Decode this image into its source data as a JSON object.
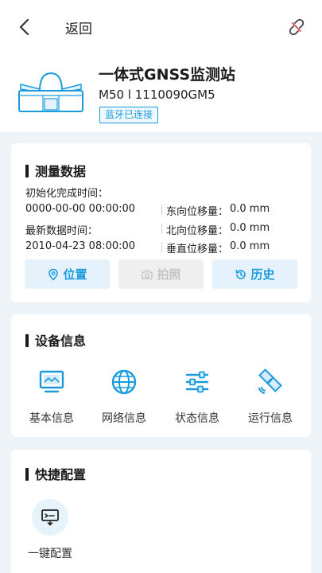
{
  "header": {
    "back_label": "返回"
  },
  "device": {
    "name": "一体式GNSS监测站",
    "model": "M50 l 1110090GM5",
    "bluetooth_status": "蓝牙已连接"
  },
  "measurement": {
    "title": "测量数据",
    "init_label": "初始化完成时间：",
    "init_time": "0000-00-00 00:00:00",
    "latest_label": "最新数据时间：",
    "latest_time": "2010-04-23 08:00:00",
    "east_label": "东向位移量：",
    "east_value": "0.0 mm",
    "north_label": "北向位移量：",
    "north_value": "0.0 mm",
    "vertical_label": "垂直位移量：",
    "vertical_value": "0.0 mm",
    "buttons": {
      "location": "位置",
      "photo": "拍照",
      "history": "历史"
    }
  },
  "device_info": {
    "title": "设备信息",
    "items": [
      {
        "label": "基本信息",
        "icon": "monitor-icon"
      },
      {
        "label": "网络信息",
        "icon": "globe-icon"
      },
      {
        "label": "状态信息",
        "icon": "sliders-icon"
      },
      {
        "label": "运行信息",
        "icon": "satellite-icon"
      }
    ]
  },
  "quick_config": {
    "title": "快捷配置",
    "items": [
      {
        "label": "一键配置",
        "icon": "one-click-config-icon"
      }
    ]
  },
  "colors": {
    "accent": "#1a9bde",
    "background": "#eef4f7",
    "disabled": "#c4c4c4"
  }
}
